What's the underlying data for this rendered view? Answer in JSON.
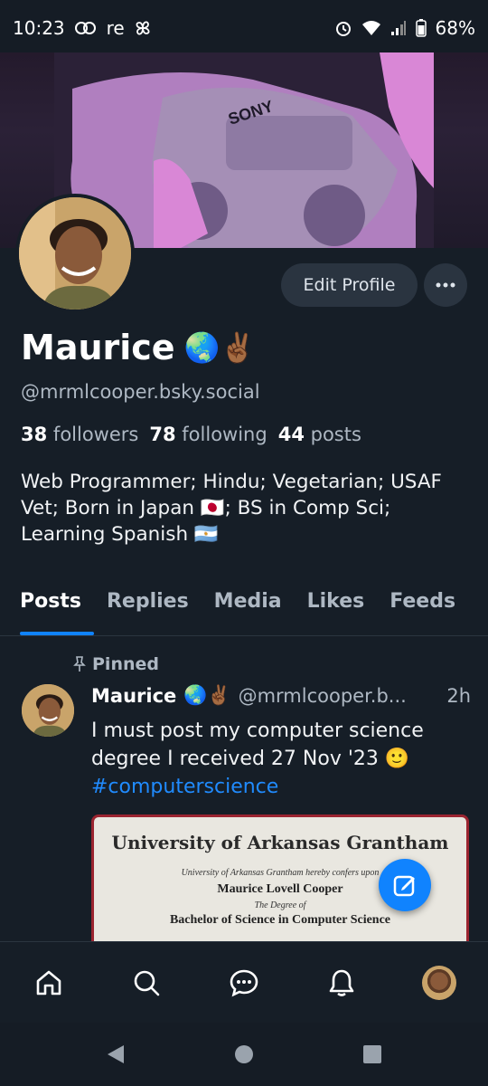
{
  "status_bar": {
    "time": "10:23",
    "carrier": "re",
    "battery": "68%"
  },
  "profile": {
    "display_name": "Maurice",
    "name_emoji": "🌏✌🏾",
    "handle": "@mrmlcooper.bsky.social",
    "followers_count": "38",
    "followers_label": "followers",
    "following_count": "78",
    "following_label": "following",
    "posts_count": "44",
    "posts_label": "posts",
    "bio": "Web Programmer; Hindu; Vegetarian; USAF Vet; Born in Japan 🇯🇵; BS in Comp Sci; Learning Spanish 🇦🇷",
    "edit_button_label": "Edit Profile"
  },
  "tabs": [
    {
      "label": "Posts",
      "active": true
    },
    {
      "label": "Replies",
      "active": false
    },
    {
      "label": "Media",
      "active": false
    },
    {
      "label": "Likes",
      "active": false
    },
    {
      "label": "Feeds",
      "active": false
    }
  ],
  "pinned_post": {
    "pinned_label": "Pinned",
    "author_name": "Maurice",
    "author_emoji": "🌏✌🏾",
    "author_handle": "@mrmlcooper.b...",
    "time": "2h",
    "text": "I must post my computer science degree I received 27 Nov '23 🙂",
    "hashtag": "#computerscience",
    "image_text": {
      "university": "University of Arkansas Grantham",
      "confers": "University of Arkansas Grantham hereby confers upon",
      "name": "Maurice Lovell Cooper",
      "degree_of": "The Degree of",
      "degree": "Bachelor of Science in Computer Science"
    }
  },
  "colors": {
    "accent": "#1083fe",
    "background": "#161e27",
    "surface": "#2a3440"
  },
  "icons": {
    "nav": [
      "home-icon",
      "search-icon",
      "chat-icon",
      "bell-icon",
      "profile-avatar"
    ],
    "fab": "compose-icon",
    "more": "ellipsis-icon"
  }
}
